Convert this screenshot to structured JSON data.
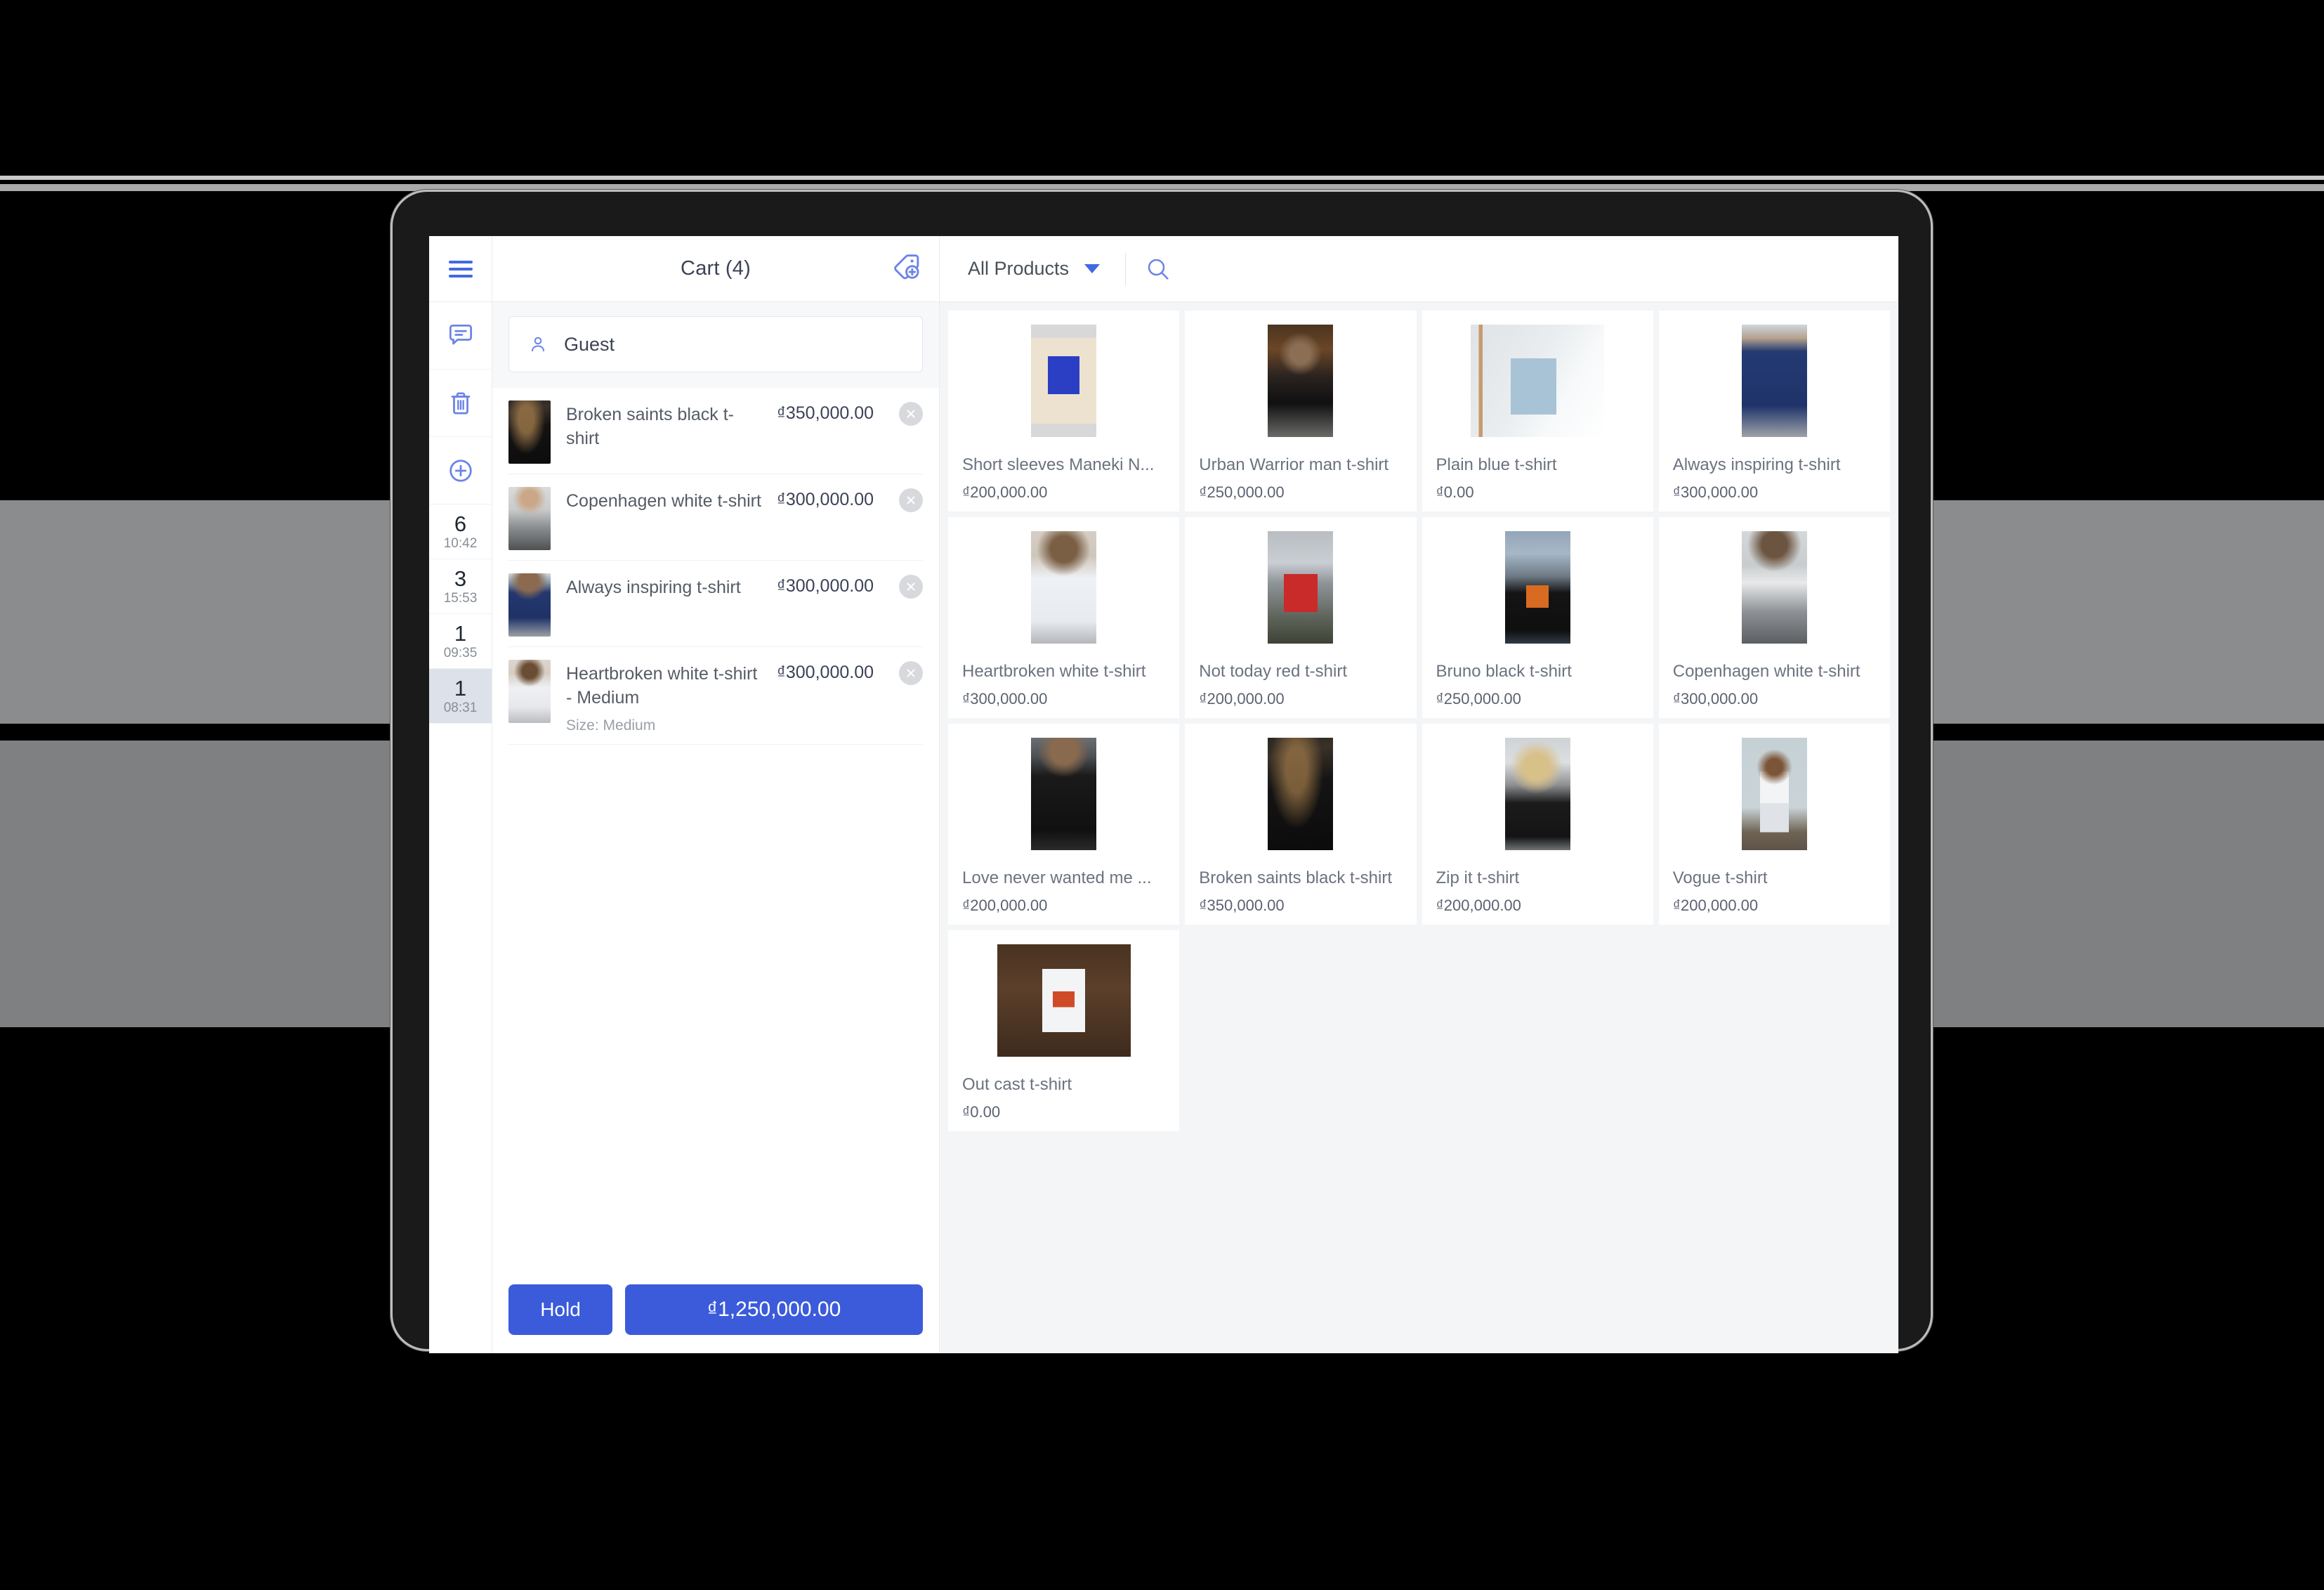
{
  "app": {
    "hamburger_icon": "hamburger-menu-icon"
  },
  "cart_header": {
    "title": "Cart (4)",
    "tag_icon": "price-tag-plus-icon"
  },
  "product_header": {
    "filter_label": "All Products",
    "caret_icon": "chevron-down-icon",
    "search_icon": "search-icon"
  },
  "rail": {
    "icons": [
      {
        "name": "note-icon",
        "label": "Note"
      },
      {
        "name": "trash-icon",
        "label": "Delete"
      },
      {
        "name": "plus-circle-icon",
        "label": "New cart"
      }
    ],
    "sessions": [
      {
        "count": "6",
        "time": "10:42",
        "active": false
      },
      {
        "count": "3",
        "time": "15:53",
        "active": false
      },
      {
        "count": "1",
        "time": "09:35",
        "active": false
      },
      {
        "count": "1",
        "time": "08:31",
        "active": true
      }
    ]
  },
  "customer": {
    "icon": "person-icon",
    "name": "Guest"
  },
  "cart_items": [
    {
      "name": "Broken saints black t-shirt",
      "price": "₫350,000.00",
      "variant": "",
      "remove_icon": "close-circle-icon"
    },
    {
      "name": "Copenhagen white t-shirt",
      "price": "₫300,000.00",
      "variant": "",
      "remove_icon": "close-circle-icon"
    },
    {
      "name": "Always inspiring t-shirt",
      "price": "₫300,000.00",
      "variant": "",
      "remove_icon": "close-circle-icon"
    },
    {
      "name": "Heartbroken white t-shirt - Medium",
      "price": "₫300,000.00",
      "variant": "Size: Medium",
      "remove_icon": "close-circle-icon"
    }
  ],
  "footer": {
    "hold_label": "Hold",
    "total_label": "₫1,250,000.00"
  },
  "products": [
    {
      "name": "Short sleeves Maneki N...",
      "price": "₫200,000.00"
    },
    {
      "name": "Urban Warrior man t-shirt",
      "price": "₫250,000.00"
    },
    {
      "name": "Plain blue t-shirt",
      "price": "₫0.00"
    },
    {
      "name": "Always inspiring t-shirt",
      "price": "₫300,000.00"
    },
    {
      "name": "Heartbroken white t-shirt",
      "price": "₫300,000.00"
    },
    {
      "name": "Not today red t-shirt",
      "price": "₫200,000.00"
    },
    {
      "name": "Bruno black t-shirt",
      "price": "₫250,000.00"
    },
    {
      "name": "Copenhagen white t-shirt",
      "price": "₫300,000.00"
    },
    {
      "name": "Love never wanted me ...",
      "price": "₫200,000.00"
    },
    {
      "name": "Broken saints black t-shirt",
      "price": "₫350,000.00"
    },
    {
      "name": "Zip it t-shirt",
      "price": "₫200,000.00"
    },
    {
      "name": "Vogue t-shirt",
      "price": "₫200,000.00"
    },
    {
      "name": "Out cast t-shirt",
      "price": "₫0.00"
    }
  ],
  "colors": {
    "accent": "#4169E1",
    "button": "#3b5bdb",
    "text_primary": "#3c4257",
    "text_muted": "#868e96",
    "panel_bg": "#f4f5f7",
    "active_session": "#dde1ea"
  }
}
